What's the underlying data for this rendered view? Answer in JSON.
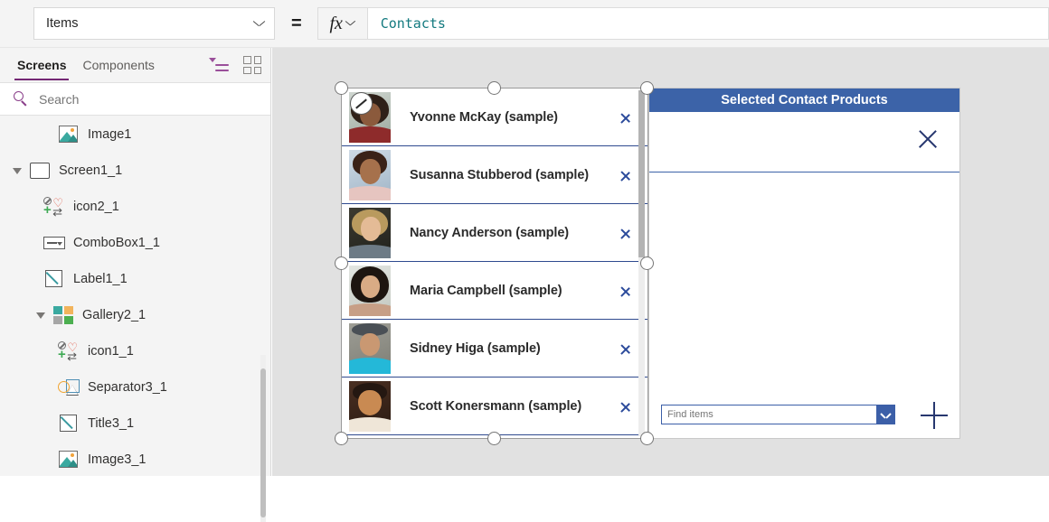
{
  "formula_bar": {
    "property_label": "Items",
    "equals": "=",
    "fx_label": "fx",
    "formula_value": "Contacts"
  },
  "sidebar": {
    "tabs": [
      {
        "label": "Screens",
        "active": true
      },
      {
        "label": "Components",
        "active": false
      }
    ],
    "toolbar_icons": [
      "filter-list-icon",
      "grid-view-icon"
    ],
    "search": {
      "placeholder": "Search",
      "value": ""
    },
    "tree": [
      {
        "label": "Image1",
        "icon": "image-icon",
        "indent": 3,
        "caret": "none"
      },
      {
        "label": "Screen1_1",
        "icon": "screen-icon",
        "indent": 0,
        "caret": "open"
      },
      {
        "label": "icon2_1",
        "icon": "icon-set-icon",
        "indent": 2,
        "caret": "none"
      },
      {
        "label": "ComboBox1_1",
        "icon": "combobox-icon",
        "indent": 2,
        "caret": "none"
      },
      {
        "label": "Label1_1",
        "icon": "label-icon",
        "indent": 2,
        "caret": "none"
      },
      {
        "label": "Gallery2_1",
        "icon": "gallery-icon",
        "indent": 1,
        "caret": "open"
      },
      {
        "label": "icon1_1",
        "icon": "icon-set-icon",
        "indent": 3,
        "caret": "none"
      },
      {
        "label": "Separator3_1",
        "icon": "separator-icon",
        "indent": 3,
        "caret": "none"
      },
      {
        "label": "Title3_1",
        "icon": "label-icon",
        "indent": 3,
        "caret": "none"
      },
      {
        "label": "Image3_1",
        "icon": "image-icon",
        "indent": 3,
        "caret": "none"
      }
    ]
  },
  "canvas": {
    "gallery": {
      "name": "gallery-control",
      "selected": true,
      "items": [
        {
          "name": "Yvonne McKay (sample)"
        },
        {
          "name": "Susanna Stubberod (sample)"
        },
        {
          "name": "Nancy Anderson (sample)"
        },
        {
          "name": "Maria Campbell (sample)"
        },
        {
          "name": "Sidney Higa (sample)"
        },
        {
          "name": "Scott Konersmann (sample)"
        }
      ]
    },
    "right_panel": {
      "title": "Selected Contact Products",
      "close_icon": "close-icon",
      "add_icon": "plus-icon",
      "find_combo": {
        "placeholder": "Find items",
        "value": ""
      }
    }
  },
  "colors": {
    "accent_purple": "#742774",
    "panel_blue": "#3c63a8",
    "formula_teal": "#137a7f",
    "chevron_blue": "#2b4a9b",
    "canvas_gray": "#e1e1e1"
  }
}
